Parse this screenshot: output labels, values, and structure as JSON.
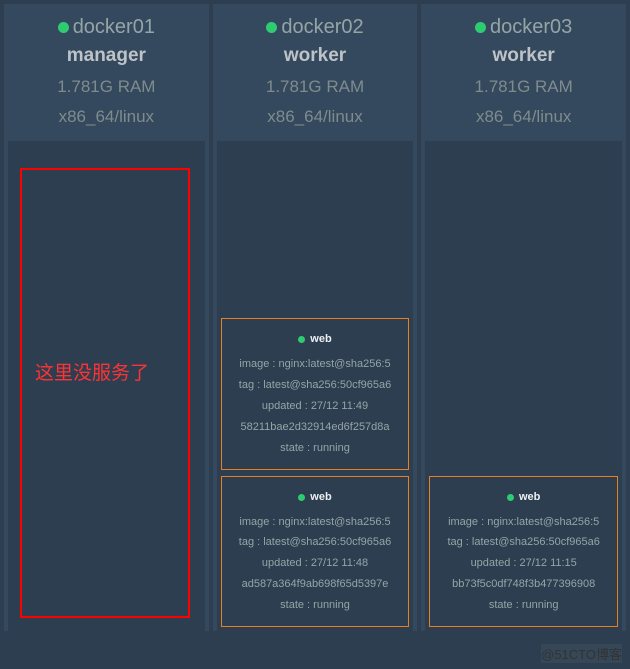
{
  "nodes": [
    {
      "name": "docker01",
      "role": "manager",
      "ram": "1.781G RAM",
      "arch": "x86_64/linux",
      "tasks": []
    },
    {
      "name": "docker02",
      "role": "worker",
      "ram": "1.781G RAM",
      "arch": "x86_64/linux",
      "tasks": [
        {
          "service": "web",
          "image": "image : nginx:latest@sha256:5",
          "tag": "tag : latest@sha256:50cf965a6",
          "updated": "updated : 27/12 11:49",
          "id": "58211bae2d32914ed6f257d8a",
          "state": "state : running"
        },
        {
          "service": "web",
          "image": "image : nginx:latest@sha256:5",
          "tag": "tag : latest@sha256:50cf965a6",
          "updated": "updated : 27/12 11:48",
          "id": "ad587a364f9ab698f65d5397e",
          "state": "state : running"
        }
      ]
    },
    {
      "name": "docker03",
      "role": "worker",
      "ram": "1.781G RAM",
      "arch": "x86_64/linux",
      "tasks": [
        {
          "service": "web",
          "image": "image : nginx:latest@sha256:5",
          "tag": "tag : latest@sha256:50cf965a6",
          "updated": "updated : 27/12 11:15",
          "id": "bb73f5c0df748f3b477396908",
          "state": "state : running"
        }
      ]
    }
  ],
  "annotation": "这里没服务了",
  "watermark": "@51CTO博客"
}
